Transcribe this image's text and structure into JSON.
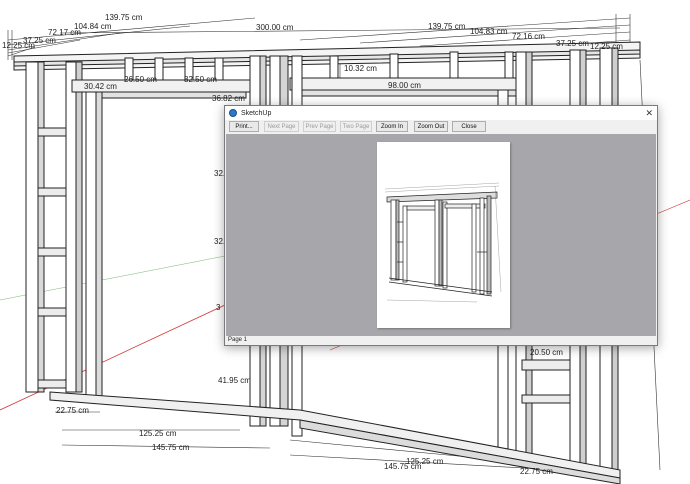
{
  "dimensions": {
    "top_left": [
      "139.75 cm",
      "104.84 cm",
      "72.17 cm",
      "37.25 cm",
      "12.25 cm"
    ],
    "top_center": "300.00 cm",
    "top_right": [
      "139.75 cm",
      "104.83 cm",
      "72.16 cm",
      "37.25 cm",
      "12.25 cm"
    ],
    "header_left": [
      "30.42 cm",
      "26.50 cm",
      "32.50 cm",
      "36.82 cm"
    ],
    "header_right": [
      "10.32 cm",
      "98.00 cm"
    ],
    "vertical_left": [
      "32.",
      "32.",
      "3"
    ],
    "lower_mid": "41.95 cm",
    "lower_right": "20.50 cm",
    "bottom": [
      "22.75 cm",
      "125.25 cm",
      "145.75 cm",
      "125.25 cm",
      "145.75 cm",
      "22.75 cm"
    ]
  },
  "window": {
    "title": "SketchUp",
    "close_icon": "close-icon",
    "toolbar": {
      "print": "Print...",
      "next_page": "Next Page",
      "prev_page": "Prev Page",
      "two_page": "Two Page",
      "zoom_in": "Zoom In",
      "zoom_out": "Zoom Out",
      "close": "Close"
    },
    "status": "Page 1"
  },
  "colors": {
    "preview_background": "#a7a6ab",
    "axis_red": "#d43a3a",
    "dimension_line": "#333333"
  }
}
